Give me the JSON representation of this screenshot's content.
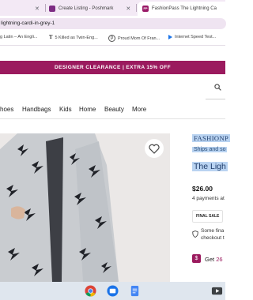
{
  "browser": {
    "tabs": [
      {
        "label": "",
        "active": false
      },
      {
        "label": "Create Listing - Poshmark",
        "active": false
      },
      {
        "label": "FashionPass The Lightning Ca",
        "active": true
      }
    ],
    "address": "lightning-cardi-in-grey-1",
    "bookmarks": [
      {
        "label": "g Latin – An Engli...",
        "icon": "page-icon"
      },
      {
        "label": "5 Killed as Twin-Eng...",
        "icon": "nyt-icon"
      },
      {
        "label": "Proud Mom Of Fran...",
        "icon": "pinterest-icon"
      },
      {
        "label": "Internet Speed Test...",
        "icon": "play-icon"
      }
    ]
  },
  "page": {
    "promo": "DESIGNER CLEARANCE | EXTRA 15% OFF",
    "nav": [
      "hoes",
      "Handbags",
      "Kids",
      "Home",
      "Beauty",
      "More"
    ],
    "product": {
      "brand": "FASHIONP",
      "ships": "Ships and so",
      "title": "The Ligh",
      "price": "$26.00",
      "payments": "4 payments at",
      "badge": "FINAL SALE",
      "final_line1": "Some fina",
      "final_line2": "checkout t",
      "get_label": "Get",
      "get_amount": "26"
    }
  },
  "colors": {
    "brand": "#9b1a5e",
    "selection": "#b9d3f1"
  },
  "taskbar": [
    "chrome-icon",
    "files-icon",
    "docs-icon",
    "video-icon"
  ]
}
